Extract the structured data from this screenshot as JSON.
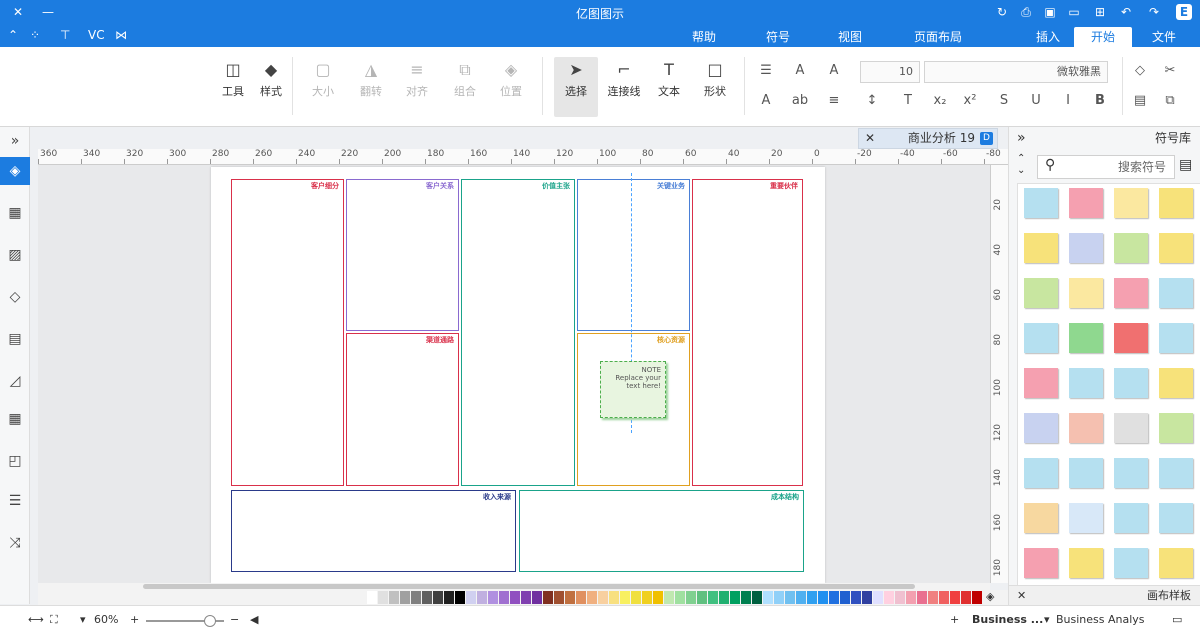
{
  "app": {
    "title": "亿图图示"
  },
  "menu": {
    "tabs": [
      "文件",
      "开始",
      "插入",
      "页面布局",
      "视图",
      "符号",
      "帮助"
    ],
    "active": "开始",
    "quick": [
      "VC"
    ]
  },
  "ribbon": {
    "buttons": [
      {
        "label": "选择",
        "icon": "pointer-icon",
        "state": "selected"
      },
      {
        "label": "连接线",
        "icon": "connector-icon",
        "state": "normal"
      },
      {
        "label": "文本",
        "icon": "text-icon",
        "state": "normal"
      },
      {
        "label": "形状",
        "icon": "shape-icon",
        "state": "normal"
      },
      {
        "label": "位置",
        "icon": "position-icon",
        "state": "disabled"
      },
      {
        "label": "组合",
        "icon": "group-icon",
        "state": "disabled"
      },
      {
        "label": "对齐",
        "icon": "align-icon",
        "state": "disabled"
      },
      {
        "label": "翻转",
        "icon": "flip-icon",
        "state": "disabled"
      },
      {
        "label": "大小",
        "icon": "size-icon",
        "state": "disabled"
      },
      {
        "label": "样式",
        "icon": "style-icon",
        "state": "normal"
      },
      {
        "label": "工具",
        "icon": "tools-icon",
        "state": "normal"
      }
    ],
    "font_name": "微软雅黑",
    "font_size": "10"
  },
  "document": {
    "tab_title": "商业分析 19"
  },
  "ruler": {
    "h_ticks": [
      "360",
      "340",
      "320",
      "300",
      "280",
      "260",
      "240",
      "220",
      "200",
      "180",
      "160",
      "140",
      "120",
      "100",
      "80",
      "60",
      "40",
      "20",
      "0",
      "-20",
      "-40",
      "-60",
      "-80"
    ],
    "v_ticks": [
      "20",
      "40",
      "60",
      "80",
      "100",
      "120",
      "140",
      "160",
      "180"
    ]
  },
  "canvas": {
    "boxes": [
      {
        "label": "重要伙伴",
        "color": "#d9304a"
      },
      {
        "label": "关键业务",
        "color": "#4a7fd6"
      },
      {
        "label": "核心资源",
        "color": "#e0a020"
      },
      {
        "label": "价值主张",
        "color": "#1aa38a"
      },
      {
        "label": "客户关系",
        "color": "#8a6ad0"
      },
      {
        "label": "渠道通路",
        "color": "#d9304a"
      },
      {
        "label": "客户细分",
        "color": "#d9304a"
      },
      {
        "label": "成本结构",
        "color": "#1aa38a"
      },
      {
        "label": "收入来源",
        "color": "#2a3a8a"
      }
    ],
    "note": {
      "title": "NOTE",
      "text": "Replace your text here!"
    }
  },
  "right_panel": {
    "title": "符号库",
    "search_placeholder": "搜索符号",
    "footer": "画布样板"
  },
  "status": {
    "page_label": "Business Analys",
    "page_tab": "Business ...",
    "zoom": "60%",
    "add_page": "+"
  },
  "palette": [
    "#c00000",
    "#e03030",
    "#f04040",
    "#f06060",
    "#f08080",
    "#e97090",
    "#f3a0b0",
    "#f0c0d0",
    "#ffd0e0",
    "#e0e0ff",
    "#3040a0",
    "#3050c0",
    "#2060d0",
    "#2070e0",
    "#2090f0",
    "#30a0f0",
    "#50b0f0",
    "#70c0f0",
    "#90d0f8",
    "#b0e0ff",
    "#006040",
    "#008050",
    "#00a060",
    "#20b070",
    "#40c080",
    "#60c080",
    "#80d090",
    "#a0e0a0",
    "#c0e8b0",
    "#f0c000",
    "#f0d020",
    "#f0e040",
    "#f8f060",
    "#f8e080",
    "#f8d0a0",
    "#f0b080",
    "#e09060",
    "#c07040",
    "#a05030",
    "#803020",
    "#7030a0",
    "#8040b0",
    "#9050c0",
    "#a070d0",
    "#b090e0",
    "#c0b0e0",
    "#d0d0f0",
    "#000000",
    "#202020",
    "#404040",
    "#606060",
    "#808080",
    "#a0a0a0",
    "#c0c0c0",
    "#e0e0e0",
    "#ffffff"
  ]
}
